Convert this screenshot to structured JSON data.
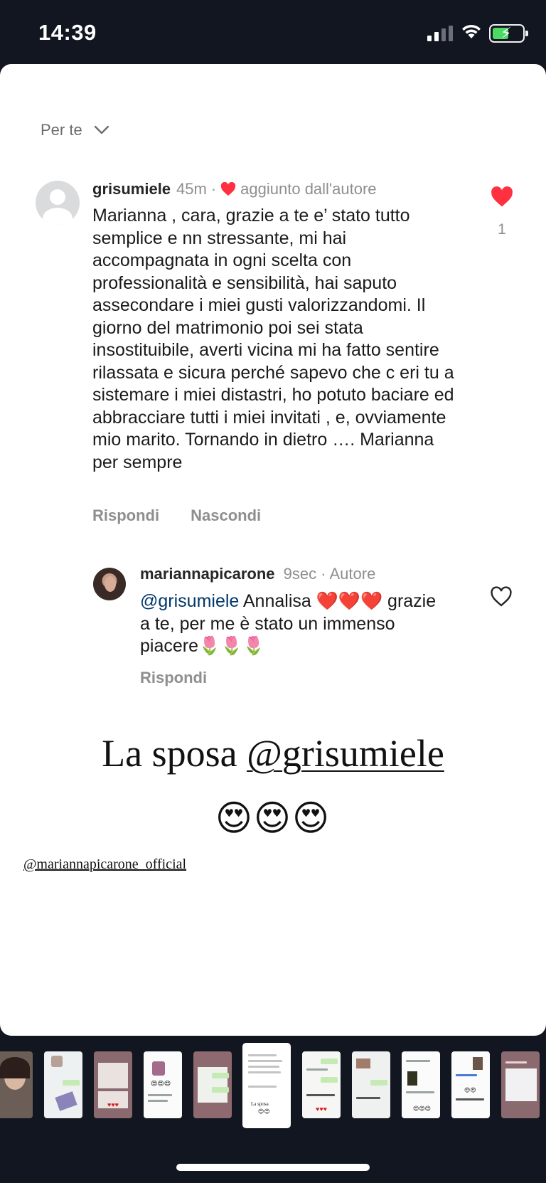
{
  "status_bar": {
    "time": "14:39",
    "signal_icon": "cellular-signal-icon",
    "wifi_icon": "wifi-icon",
    "battery_icon": "battery-charging-icon",
    "battery_color": "#4cd964"
  },
  "comments": {
    "sort_label": "Per te",
    "main": {
      "username": "grisumiele",
      "time": "45m",
      "separator": "·",
      "liked_by_author": "aggiunto dall'autore",
      "text": "Marianna , cara, grazie a te e’ stato tutto semplice e nn stressante, mi hai accompagnata in ogni scelta con professionalità e sensibilità, hai saputo assecondare i miei gusti valorizzandomi. Il giorno del matrimonio poi sei stata insostituibile, averti vicina mi ha fatto sentire rilassata e sicura perché sapevo che c eri tu a sistemare i miei distastri, ho potuto baciare ed abbracciare tutti i miei invitati , e, ovviamente mio marito. Tornando in dietro …. Marianna per sempre",
      "reply_label": "Rispondi",
      "hide_label": "Nascondi",
      "like_count": "1",
      "like_color": "#ff3040"
    },
    "reply": {
      "username": "mariannapicarone",
      "time": "9sec",
      "separator": "·",
      "author_label": "Autore",
      "mention": "@grisumiele",
      "text": " Annalisa ❤️❤️❤️ grazie a te, per me è stato un immenso piacere🌷🌷🌷",
      "reply_label": "Rispondi"
    }
  },
  "story": {
    "caption_prefix": "La sposa ",
    "caption_tag": "@grisumiele",
    "emojis": "😍😍😍",
    "sticker": "@mariannapicarone_official"
  },
  "thumbnails": {
    "count": 11,
    "active_index": 5
  }
}
